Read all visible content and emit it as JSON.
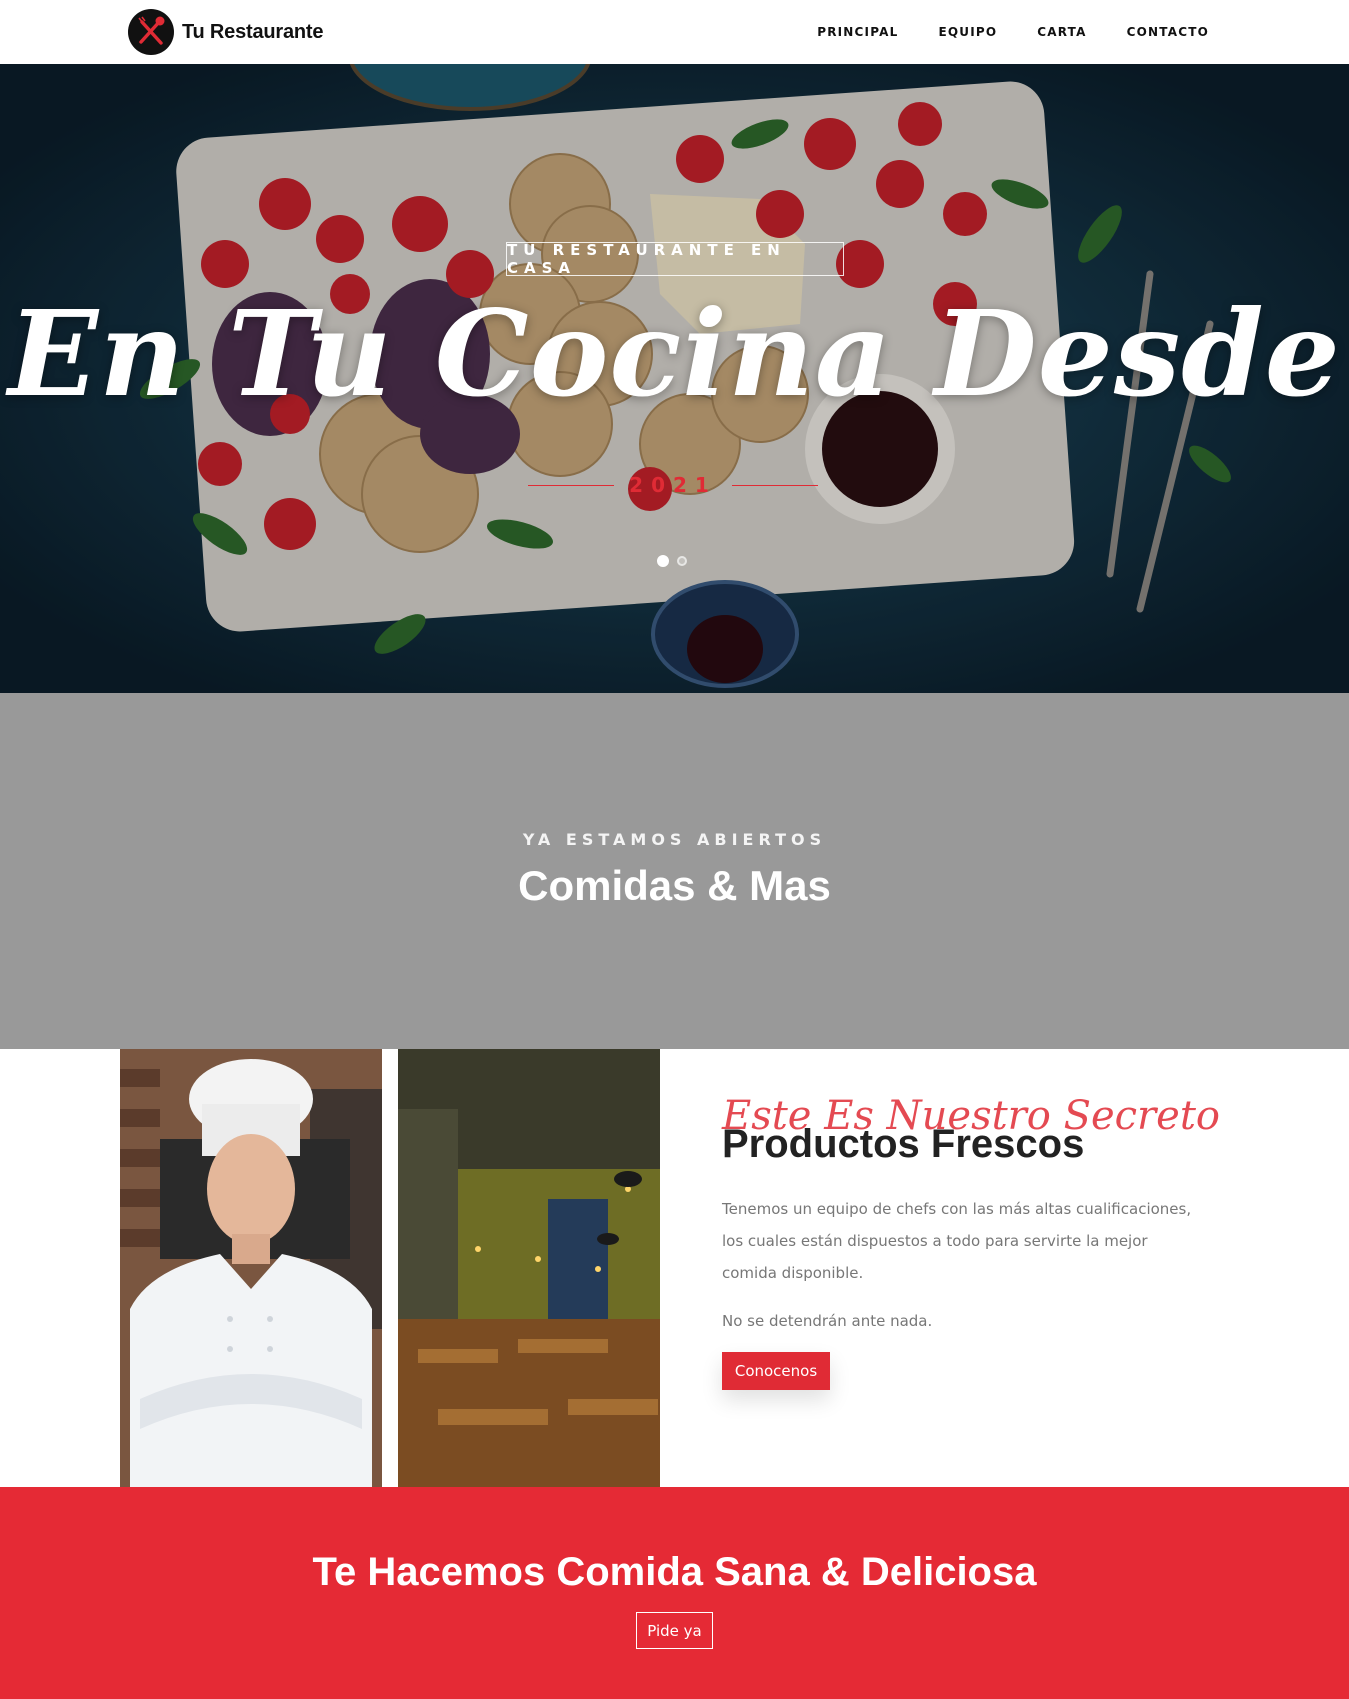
{
  "navbar": {
    "brand_name": "Tu Restaurante",
    "logo_icon": "crossed-fork-spoon-icon",
    "links": [
      "PRINCIPAL",
      "EQUIPO",
      "CARTA",
      "CONTACTO"
    ]
  },
  "hero": {
    "kicker": "TU RESTAURANTE EN CASA",
    "title": "En Tu Cocina Desde",
    "year": "2021",
    "slides_total": 2,
    "active_slide": 1
  },
  "band": {
    "kicker": "YA ESTAMOS ABIERTOS",
    "title": "Comidas & Mas"
  },
  "about": {
    "script_heading": "Este Es Nuestro Secreto",
    "title": "Productos Frescos",
    "paragraph1": "Tenemos un equipo de chefs con las más altas cualificaciones, los cuales están dispuestos a todo para servirte la mejor comida disponible.",
    "paragraph2": "No se detendrán ante nada.",
    "button_label": "Conocenos"
  },
  "cta": {
    "title": "Te Hacemos Comida Sana & Deliciosa",
    "button_label": "Pide ya"
  },
  "colors": {
    "accent_red": "#e52a35",
    "band_gray": "#999999",
    "hero_blue": "#123449"
  }
}
